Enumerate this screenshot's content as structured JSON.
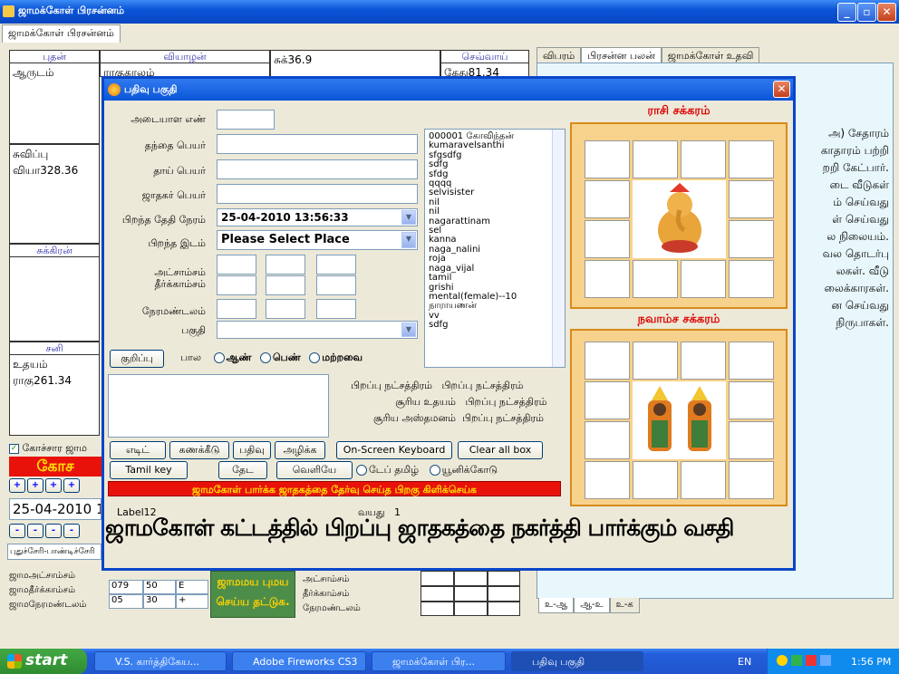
{
  "window": {
    "title": "ஜாமக்கோள் பிரசன்னம்",
    "tab": "ஜாமக்கோள் பிரசன்னம்",
    "min": "_",
    "max": "▫",
    "close": "✕"
  },
  "grid": {
    "c1h": "புதன்",
    "c1t": "ஆருடம்",
    "c2h": "வியாழன்",
    "c2t": "ராகுகாலம்",
    "c3t": "சுக்36.9",
    "c4h": "செவ்வாய்",
    "c4t": "கேது81.34",
    "c5t1": "சுவிப்பு",
    "c5t2": "வியா328.36",
    "c6h": "சுக்கிரன்",
    "c7h": "சனி",
    "c7t1": "உதயம்",
    "c7t2": "ராகு261.34"
  },
  "left": {
    "checkbox": "கோச்சார ஜாம",
    "kosu": "கோச",
    "date": "25-04-2010 1",
    "place": "புதுச்சேரி-பாண்டிச்சேரி",
    "r1": "ஜாமஅட்சாம்சம்",
    "r2": "ஜாமதீர்க்காம்சம்",
    "r3": "ஜாமநேரமண்டலம்",
    "t1": [
      "079",
      "50",
      "E"
    ],
    "t2": [
      "05",
      "30",
      "+"
    ],
    "badge1": "ஜாமமய புமய",
    "badge2": "செய்ய தட்டுக.",
    "b1": "அட்சாம்சம்",
    "b2": "தீர்க்காம்சம்",
    "b3": "நேரமண்டலம்"
  },
  "right": {
    "tabs": [
      "விபரம்",
      "பிரசன்ன பலன்",
      "ஜாமக்கோள் உதவி"
    ],
    "lines": [
      "அ) சேதாரம்",
      "காதாரம் பற்றி",
      "றறி கேட்பார்.",
      "டை வீடுகள்",
      "ம் செய்வது",
      "ள் செய்வது",
      "ல நிலையம்.",
      "வல தொடர்பு",
      "லகள். வீடு",
      "லைக்காரகள்.",
      "ன செய்வது",
      "நிருபாகள்."
    ],
    "bottomtabs": [
      "உ-ஆ",
      "ஆ-உ",
      "உ-க"
    ]
  },
  "dialog": {
    "title": "பதிவு பகுதி",
    "id": "அடையாள எண்",
    "father": "தந்தை பெயர்",
    "mother": "தாய் பெயர்",
    "jathakar": "ஜாதகர் பெயர்",
    "birthdt": "பிறந்த தேதி நேரம்",
    "birthdt_val": "25-04-2010 13:56:33",
    "place": "பிறந்த இடம்",
    "place_val": "Please Select Place",
    "lat": "அட்சாம்சம்",
    "lon": "தீர்க்காம்சம்",
    "tz": "நேரமண்டலம்",
    "part": "பகுதி",
    "note": "குறிப்பு",
    "gender": "பால",
    "male": "ஆண்",
    "female": "பெண்",
    "other": "மற்றவை",
    "names": [
      "000001 கோவிந்தன்",
      "kumaravelsanthi",
      "sfgsdfg",
      "sdfg",
      "sfdg",
      "qqqq",
      "selvisister",
      "nil",
      "nil",
      "nagarattinam",
      "sel",
      "kanna",
      "naga_nalini",
      "roja",
      "naga_vijal",
      "tamil",
      "grishi",
      "mental(female)--10",
      "நாராயணன்",
      "vv",
      "sdfg"
    ],
    "i1a": "பிறப்பு நட்சத்திரம்",
    "i1b": "பிறப்பு நட்சத்திரம்",
    "i2a": "சூரிய உதயம்",
    "i2b": "பிறப்பு நட்சத்திரம்",
    "i3a": "சூரிய அஸ்தமனம்",
    "i3b": "பிறப்பு நட்சத்திரம்",
    "btn_edit": "எடிட்",
    "btn_calc": "கணக்கீடு",
    "btn_save": "பதிவு",
    "btn_del": "அழிக்க",
    "btn_osk": "On-Screen Keyboard",
    "btn_clear": "Clear all box",
    "btn_tamilkb": "Tamil key board",
    "btn_search": "தேட",
    "btn_exit": "வெளியே",
    "tape": "டேப் தமிழ்",
    "unicode": "யூனிக்கோடு",
    "redbar": "ஜாமகோள் பார்க்க ஜாதகத்தை தேர்வு செய்த பிறகு கிளிக்செய்க",
    "label12": "Label12",
    "age": "வயது",
    "age_val": "1",
    "rasi": "ராசி சக்கரம்",
    "navamsa": "நவாம்ச சக்கரம்"
  },
  "caption": "ஜாமகோள் கட்டத்தில் பிறப்பு ஜாதகத்தை நகர்த்தி பார்க்கும் வசதி",
  "taskbar": {
    "start": "start",
    "items": [
      "V.S. கார்த்திகேய...",
      "Adobe Fireworks CS3",
      "ஜாமக்கோள் பிர...",
      "பதிவு பகுதி"
    ],
    "lang": "EN",
    "time": "1:56 PM"
  }
}
